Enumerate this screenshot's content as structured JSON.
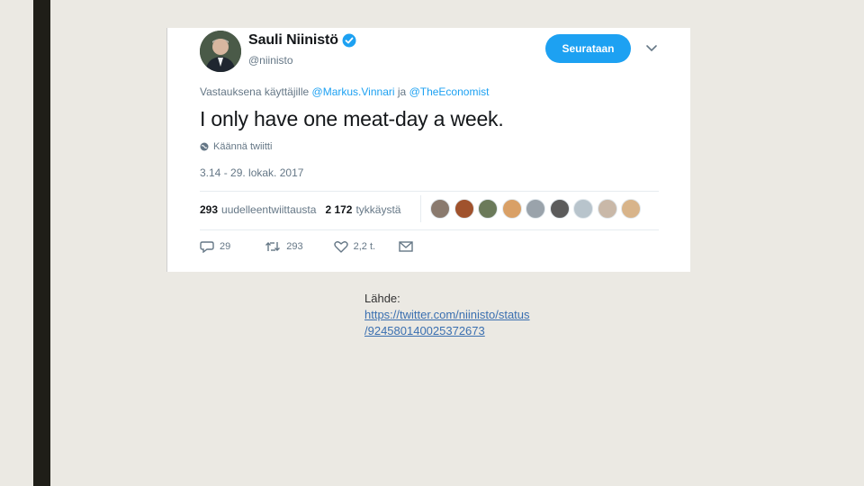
{
  "tweet": {
    "display_name": "Sauli Niinistö",
    "handle": "@niinisto",
    "follow_label": "Seurataan",
    "reply_prefix": "Vastauksena käyttäjille",
    "reply_mention_1": "@Markus.Vinnari",
    "reply_joiner": "ja",
    "reply_mention_2": "@TheEconomist",
    "text": "I only have one meat-day a week.",
    "translate_label": "Käännä twiitti",
    "timestamp": "3.14 - 29. lokak. 2017",
    "retweets_count": "293",
    "retweets_label": "uudelleentwiittausta",
    "likes_count": "2 172",
    "likes_label": "tykkäystä",
    "actions": {
      "reply_count": "29",
      "retweet_count": "293",
      "like_count": "2,2 t."
    },
    "liker_avatar_colors": [
      "#8a7a6e",
      "#a0522d",
      "#6b7a5a",
      "#d9a066",
      "#9aa3ab",
      "#5b5b5b",
      "#b8c4cc",
      "#c9b8a8",
      "#d8b48a"
    ]
  },
  "source": {
    "label": "Lähde:",
    "link_line_1": "https://twitter.com/niinisto/status",
    "link_line_2": "/924580140025372673"
  },
  "colors": {
    "accent": "#1da1f2",
    "background": "#ebe9e3",
    "left_bar": "#1f1e18"
  }
}
